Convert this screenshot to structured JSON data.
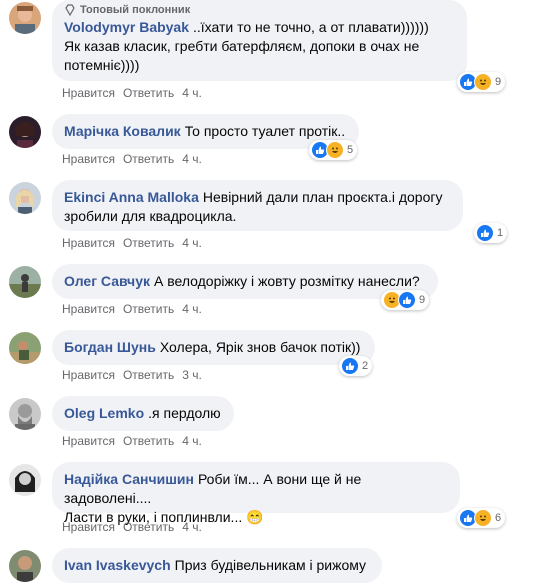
{
  "comments": [
    {
      "author": "Volodymyr Babyak",
      "badge": "Топовый поклонник",
      "text": "..їхати то не точно, а от плавати))))))\nЯк казав класик, гребти батерфляєм, допоки в очах не потемніє))))",
      "like": "Нравится",
      "reply": "Ответить",
      "time": "4 ч.",
      "reactions": "9"
    },
    {
      "author": "Марічка Ковалик",
      "text": "То просто туалет протік..",
      "like": "Нравится",
      "reply": "Ответить",
      "time": "4 ч.",
      "reactions": "5"
    },
    {
      "author": "Ekinci Anna Malloka",
      "text": "Невірний дали план проєкта.і дорогу зробили для квадроцикла.",
      "like": "Нравится",
      "reply": "Ответить",
      "time": "4 ч.",
      "reactions": "1"
    },
    {
      "author": "Олег Савчук",
      "text": "А велодоріжку і жовту розмітку нанесли?",
      "like": "Нравится",
      "reply": "Ответить",
      "time": "4 ч.",
      "reactions": "9"
    },
    {
      "author": "Богдан Шунь",
      "text": "Холера, Ярік знов бачок потік))",
      "like": "Нравится",
      "reply": "Ответить",
      "time": "3 ч.",
      "reactions": "2"
    },
    {
      "author": "Oleg Lemko",
      "text": ".я пердолю",
      "like": "Нравится",
      "reply": "Ответить",
      "time": "4 ч."
    },
    {
      "author": "Надійка Санчишин",
      "text": "Роби їм... А вони ще й не задоволені....\nЛасти в руки, і поплинвли... 😁",
      "like": "Нравится",
      "reply": "Ответить",
      "time": "4 ч.",
      "reactions": "6"
    },
    {
      "author": "Ivan Ivaskevych",
      "text": "Приз будівельникам і рижому"
    }
  ]
}
